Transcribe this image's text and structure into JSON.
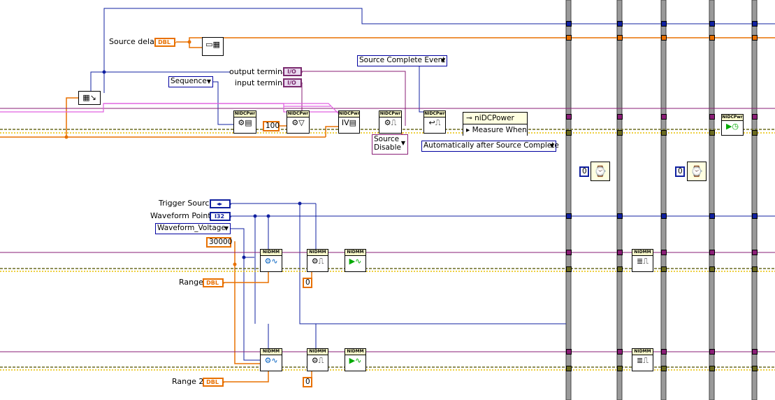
{
  "labels": {
    "source_delay": "Source delay",
    "output_terminal": "output terminal",
    "input_terminal": "input terminal",
    "trigger_source": "Trigger Source",
    "waveform_points": "Waveform Points",
    "range": "Range",
    "range2": "Range 2"
  },
  "terminals": {
    "dbl": "DBL",
    "io": "I/O",
    "i32": "I32",
    "ring": "◂▸"
  },
  "controls": {
    "sequence": "Sequence",
    "source_complete_event": "Source Complete Event",
    "waveform_voltage": "Waveform_Voltage",
    "automatically_after": "Automatically after Source Complete",
    "source_disable_line1": "Source",
    "source_disable_line2": "Disable"
  },
  "constants": {
    "c100": "100",
    "c30000": "30000",
    "zero": "0"
  },
  "nodes": {
    "nidcpwr": "NIDCPwr",
    "nidmm": "NIDMM"
  },
  "property_node": {
    "class": "niDCPower",
    "property": "Measure When"
  },
  "colors": {
    "orange_wire": "#e87000",
    "blue_wire": "#1020a0",
    "purple_wire": "#8a1e76",
    "pink_wire": "#e060e0",
    "error_wire": "#6b6b20",
    "loop_border": "#888888"
  }
}
